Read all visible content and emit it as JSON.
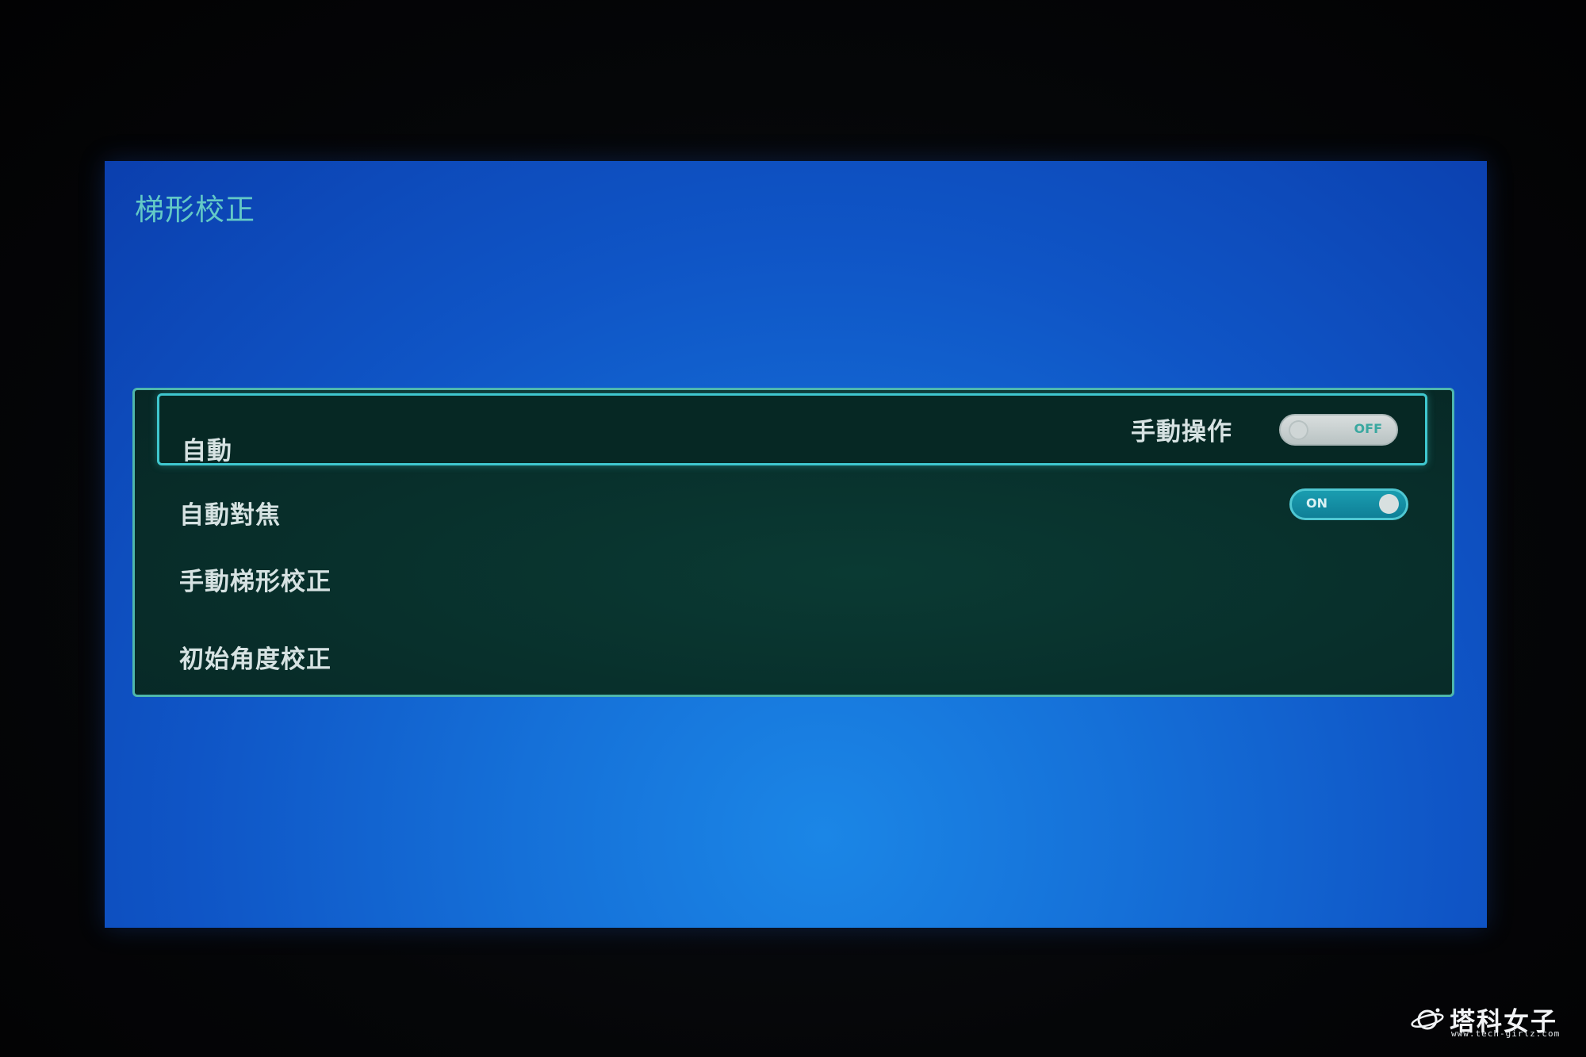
{
  "screen": {
    "title": "梯形校正"
  },
  "menu": {
    "items": [
      {
        "label": "自動",
        "sub_label": "手動操作",
        "toggle": {
          "state": "OFF"
        },
        "selected": true
      },
      {
        "label": "自動對焦",
        "toggle": {
          "state": "ON"
        }
      },
      {
        "label": "手動梯形校正"
      },
      {
        "label": "初始角度校正"
      }
    ]
  },
  "watermark": {
    "name": "塔科女子",
    "url": "www.tech-girlz.com"
  },
  "colors": {
    "screen_blue": "#1570d8",
    "panel_green": "#082f2b",
    "accent_cyan": "#3fc7cf",
    "title_teal": "#63c9c6"
  }
}
